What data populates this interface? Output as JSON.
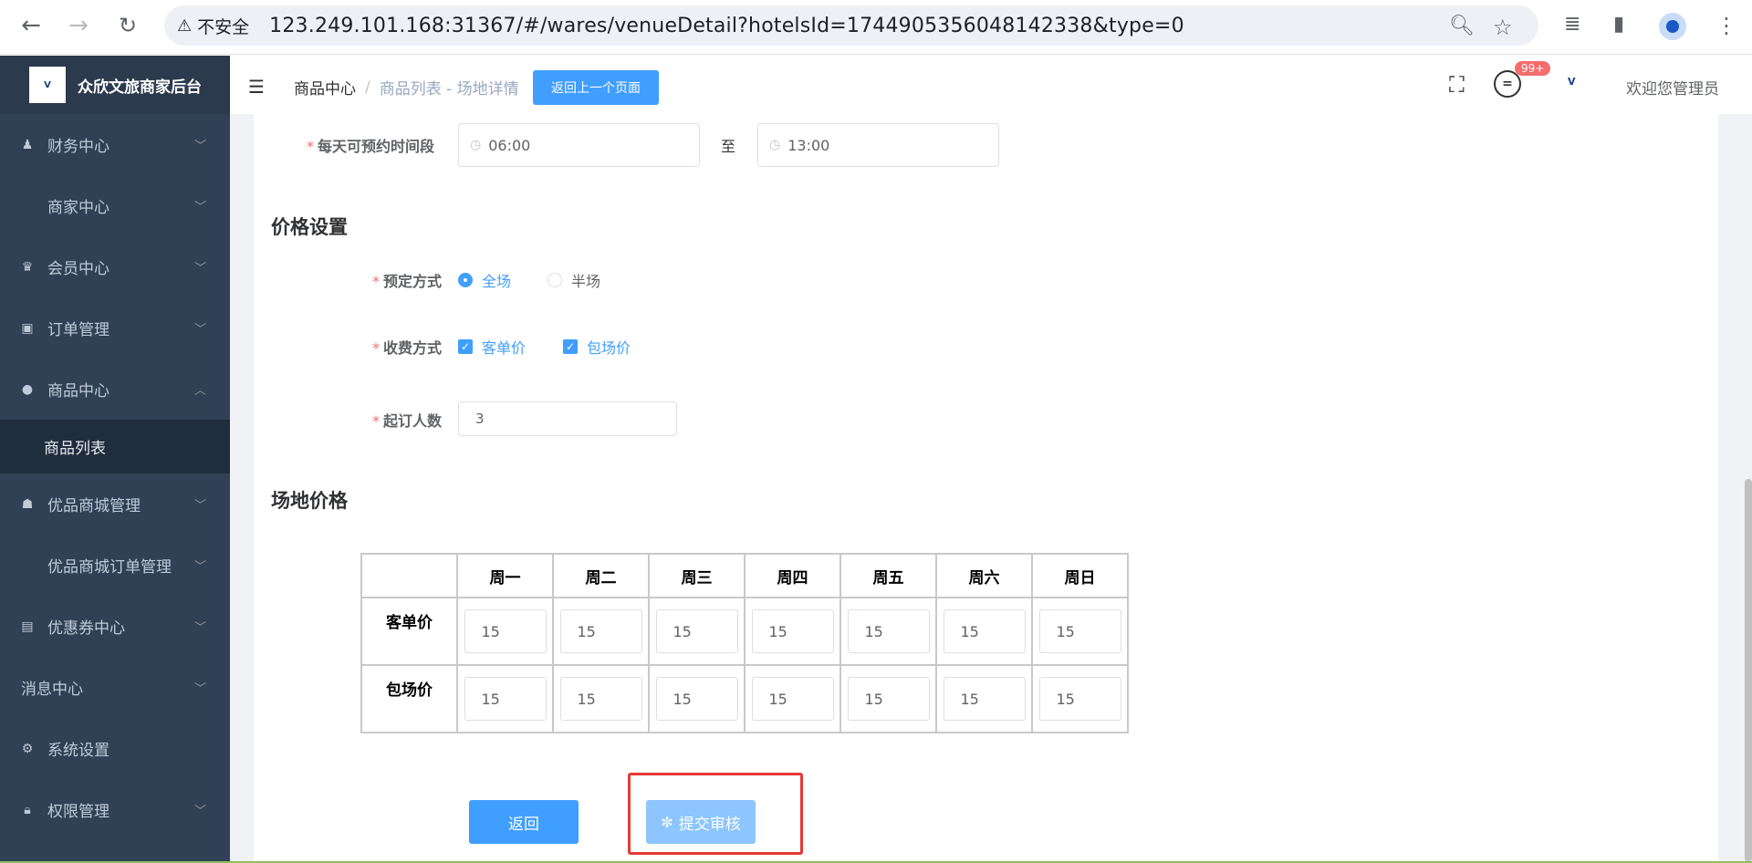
{
  "browser": {
    "insecure_label": "不安全",
    "url": "123.249.101.168:31367/#/wares/venueDetail?hotelsId=1744905356048142338&type=0"
  },
  "sidebar": {
    "app_title": "众欣文旅商家后台",
    "logo_text": "V",
    "items": [
      {
        "label": "财务中心"
      },
      {
        "label": "商家中心"
      },
      {
        "label": "会员中心"
      },
      {
        "label": "订单管理"
      },
      {
        "label": "商品中心"
      },
      {
        "label": "商品列表"
      },
      {
        "label": "优品商城管理"
      },
      {
        "label": "优品商城订单管理"
      },
      {
        "label": "优惠券中心"
      },
      {
        "label": "消息中心"
      },
      {
        "label": "系统设置"
      },
      {
        "label": "权限管理"
      }
    ]
  },
  "header": {
    "breadcrumb_first": "商品中心",
    "breadcrumb_sep": "/",
    "breadcrumb_last": "商品列表 - 场地详情",
    "back_page_label": "返回上一个页面",
    "msg_badge": "99+",
    "welcome": "欢迎您管理员"
  },
  "form": {
    "time_label": "每天可预约时间段",
    "time_start": "06:00",
    "time_to": "至",
    "time_end": "13:00",
    "price_section": "价格设置",
    "booking_label": "预定方式",
    "booking_full": "全场",
    "booking_half": "半场",
    "fee_label": "收费方式",
    "fee_per_person": "客单价",
    "fee_whole": "包场价",
    "min_people_label": "起订人数",
    "min_people_value": "3",
    "venue_price_section": "场地价格",
    "required_mark": "*"
  },
  "price_table": {
    "headers": [
      "周一",
      "周二",
      "周三",
      "周四",
      "周五",
      "周六",
      "周日"
    ],
    "rows": [
      {
        "label": "客单价",
        "values": [
          "15",
          "15",
          "15",
          "15",
          "15",
          "15",
          "15"
        ]
      },
      {
        "label": "包场价",
        "values": [
          "15",
          "15",
          "15",
          "15",
          "15",
          "15",
          "15"
        ]
      }
    ]
  },
  "actions": {
    "return_label": "返回",
    "submit_label": "提交审核"
  },
  "colors": {
    "primary": "#409eff",
    "sidebar_bg": "#304156",
    "highlight": "#e53935"
  }
}
